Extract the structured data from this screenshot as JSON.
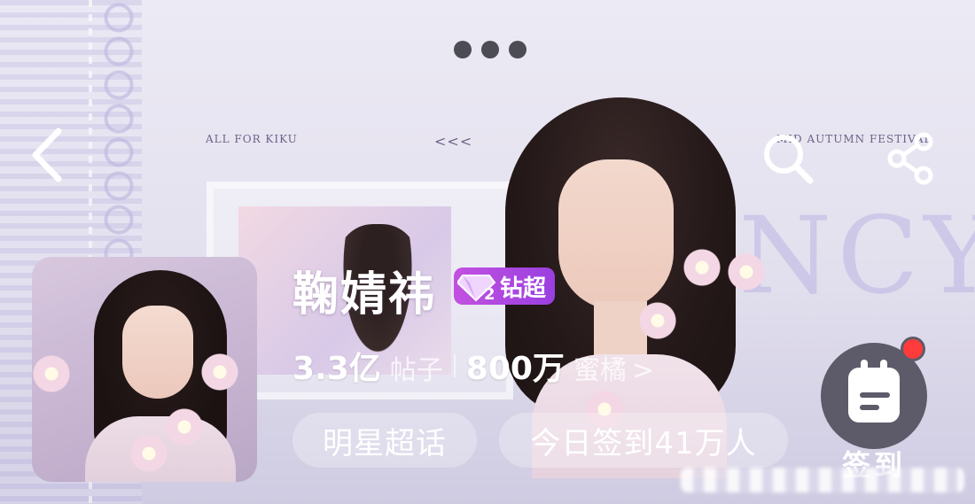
{
  "header": {
    "more_menu": "more-options",
    "back": "back",
    "search": "search",
    "share": "share"
  },
  "decor": {
    "left_caption": "ALL FOR KIKU",
    "arrows": "<<<",
    "right_caption": "MID AUTUMN FESTIVAL",
    "watermark": "INCYI"
  },
  "profile": {
    "name": "鞠婧祎",
    "badge_level": "2",
    "badge_label": "钻超"
  },
  "stats": {
    "posts_value": "3.3亿",
    "posts_label": "帖子",
    "fans_value": "800万",
    "fans_label": "蜜橘",
    "fans_chevron": ">"
  },
  "buttons": {
    "category": "明星超话",
    "checkin_count": "今日签到41万人"
  },
  "checkin": {
    "label": "签到"
  },
  "colors": {
    "badge": "#b048e0",
    "checkin_bg": "#5d5b69",
    "notification_dot": "#ff3b3b"
  }
}
